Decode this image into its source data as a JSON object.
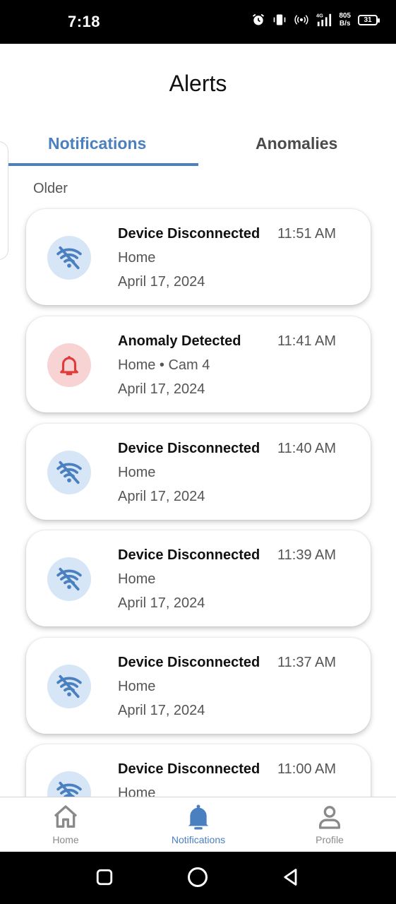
{
  "status_bar": {
    "time": "7:18",
    "net_speed_value": "805",
    "net_speed_unit": "B/s",
    "battery": "31",
    "signal_label": "4G"
  },
  "page": {
    "title": "Alerts"
  },
  "tabs": [
    {
      "label": "Notifications",
      "active": true
    },
    {
      "label": "Anomalies",
      "active": false
    }
  ],
  "section_label": "Older",
  "notifications": [
    {
      "title": "Device Disconnected",
      "time": "11:51 AM",
      "subtitle": "Home",
      "date": "April 17, 2024",
      "icon": "wifi-off-icon"
    },
    {
      "title": "Anomaly Detected",
      "time": "11:41 AM",
      "subtitle": "Home • Cam 4",
      "date": "April 17, 2024",
      "icon": "bell-icon"
    },
    {
      "title": "Device Disconnected",
      "time": "11:40 AM",
      "subtitle": "Home",
      "date": "April 17, 2024",
      "icon": "wifi-off-icon"
    },
    {
      "title": "Device Disconnected",
      "time": "11:39 AM",
      "subtitle": "Home",
      "date": "April 17, 2024",
      "icon": "wifi-off-icon"
    },
    {
      "title": "Device Disconnected",
      "time": "11:37 AM",
      "subtitle": "Home",
      "date": "April 17, 2024",
      "icon": "wifi-off-icon"
    },
    {
      "title": "Device Disconnected",
      "time": "11:00 AM",
      "subtitle": "Home",
      "date": "",
      "icon": "wifi-off-icon"
    }
  ],
  "bottom_nav": {
    "home": "Home",
    "notifications": "Notifications",
    "profile": "Profile"
  },
  "colors": {
    "accent": "#4a7fc0",
    "alert_red": "#e03a3a",
    "icon_blue_bg": "#d6e6f7",
    "icon_red_bg": "#f8d3d3"
  }
}
